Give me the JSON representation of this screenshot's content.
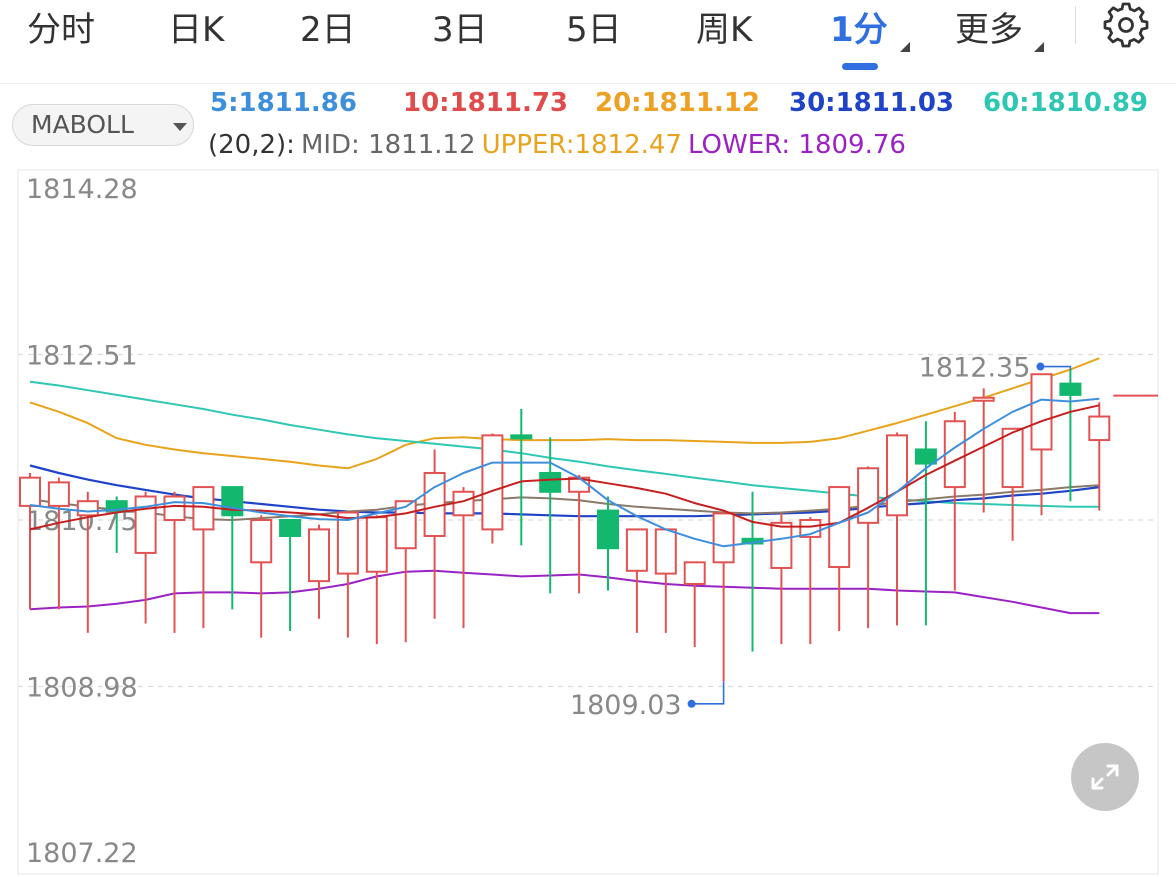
{
  "tabs": [
    {
      "label": "分时"
    },
    {
      "label": "日K"
    },
    {
      "label": "2日"
    },
    {
      "label": "3日"
    },
    {
      "label": "5日"
    },
    {
      "label": "周K"
    },
    {
      "label": "1分"
    },
    {
      "label": "更多"
    }
  ],
  "active_tab": "1分",
  "indicator_select": "MABOLL",
  "ma": {
    "ma5": "5:1811.86",
    "ma10": "10:1811.73",
    "ma20": "20:1811.12",
    "ma30": "30:1811.03",
    "ma60": "60:1810.89"
  },
  "boll": {
    "params": "(20,2):",
    "mid": "MID: 1811.12",
    "upper": "UPPER:1812.47",
    "lower": "LOWER: 1809.76"
  },
  "colors": {
    "accent": "#2f6fe0",
    "ma5": "#3d8fdc",
    "ma10": "#e04b4b",
    "ma20": "#eea022",
    "ma30": "#1f44c8",
    "ma60": "#2ec7b3",
    "boll_upper": "#e8a21c",
    "boll_mid": "#8a7a6a",
    "boll_lower": "#9a22c4",
    "up": "#e15252",
    "down": "#12b86d"
  },
  "chart_data": {
    "type": "candlestick",
    "y_ticks": [
      "1814.28",
      "1812.51",
      "1810.75",
      "1808.98",
      "1807.22"
    ],
    "ylim": [
      1807.22,
      1814.28
    ],
    "high_marker": "1812.35",
    "low_marker": "1809.03",
    "candles": [
      {
        "o": 1810.9,
        "c": 1811.2,
        "h": 1811.25,
        "l": 1809.8
      },
      {
        "o": 1810.9,
        "c": 1811.15,
        "h": 1811.2,
        "l": 1809.8
      },
      {
        "o": 1810.8,
        "c": 1810.95,
        "h": 1811.05,
        "l": 1809.55
      },
      {
        "o": 1810.95,
        "c": 1810.85,
        "h": 1811.0,
        "l": 1810.4
      },
      {
        "o": 1810.4,
        "c": 1811.0,
        "h": 1811.05,
        "l": 1809.65
      },
      {
        "o": 1810.75,
        "c": 1811.0,
        "h": 1811.05,
        "l": 1809.55
      },
      {
        "o": 1810.65,
        "c": 1811.1,
        "h": 1811.1,
        "l": 1809.6
      },
      {
        "o": 1811.1,
        "c": 1810.8,
        "h": 1811.1,
        "l": 1809.8
      },
      {
        "o": 1810.3,
        "c": 1810.75,
        "h": 1810.8,
        "l": 1809.5
      },
      {
        "o": 1810.75,
        "c": 1810.58,
        "h": 1810.75,
        "l": 1809.57
      },
      {
        "o": 1810.1,
        "c": 1810.65,
        "h": 1810.7,
        "l": 1809.7
      },
      {
        "o": 1810.18,
        "c": 1810.83,
        "h": 1810.84,
        "l": 1809.5
      },
      {
        "o": 1810.2,
        "c": 1810.78,
        "h": 1810.8,
        "l": 1809.43
      },
      {
        "o": 1810.45,
        "c": 1810.95,
        "h": 1810.95,
        "l": 1809.45
      },
      {
        "o": 1810.58,
        "c": 1811.25,
        "h": 1811.5,
        "l": 1809.7
      },
      {
        "o": 1810.8,
        "c": 1811.05,
        "h": 1811.1,
        "l": 1809.6
      },
      {
        "o": 1810.65,
        "c": 1811.65,
        "h": 1811.67,
        "l": 1810.5
      },
      {
        "o": 1811.65,
        "c": 1811.64,
        "h": 1811.93,
        "l": 1810.48
      },
      {
        "o": 1811.25,
        "c": 1811.05,
        "h": 1811.63,
        "l": 1809.97
      },
      {
        "o": 1811.05,
        "c": 1811.2,
        "h": 1811.23,
        "l": 1809.97
      },
      {
        "o": 1810.85,
        "c": 1810.45,
        "h": 1811.0,
        "l": 1810.0
      },
      {
        "o": 1810.21,
        "c": 1810.65,
        "h": 1810.65,
        "l": 1809.55
      },
      {
        "o": 1810.18,
        "c": 1810.65,
        "h": 1810.65,
        "l": 1809.55
      },
      {
        "o": 1810.07,
        "c": 1810.3,
        "h": 1810.3,
        "l": 1809.4
      },
      {
        "o": 1810.3,
        "c": 1810.82,
        "h": 1810.82,
        "l": 1809.03
      },
      {
        "o": 1810.55,
        "c": 1810.5,
        "h": 1811.05,
        "l": 1809.35
      },
      {
        "o": 1810.24,
        "c": 1810.72,
        "h": 1810.82,
        "l": 1809.43
      },
      {
        "o": 1810.57,
        "c": 1810.75,
        "h": 1810.78,
        "l": 1809.43
      },
      {
        "o": 1810.25,
        "c": 1811.1,
        "h": 1811.11,
        "l": 1809.57
      },
      {
        "o": 1810.72,
        "c": 1811.3,
        "h": 1811.32,
        "l": 1809.6
      },
      {
        "o": 1810.8,
        "c": 1811.65,
        "h": 1811.68,
        "l": 1809.63
      },
      {
        "o": 1811.5,
        "c": 1811.35,
        "h": 1811.8,
        "l": 1809.63
      },
      {
        "o": 1811.1,
        "c": 1811.8,
        "h": 1811.9,
        "l": 1810.0
      },
      {
        "o": 1812.05,
        "c": 1812.05,
        "h": 1812.15,
        "l": 1810.83
      },
      {
        "o": 1811.1,
        "c": 1811.72,
        "h": 1811.72,
        "l": 1810.53
      },
      {
        "o": 1811.5,
        "c": 1812.3,
        "h": 1812.3,
        "l": 1810.8
      },
      {
        "o": 1812.2,
        "c": 1812.08,
        "h": 1812.35,
        "l": 1810.95
      },
      {
        "o": 1811.6,
        "c": 1811.85,
        "h": 1812.0,
        "l": 1810.85
      }
    ],
    "series": [
      {
        "name": "5",
        "values": [
          1810.91,
          1810.87,
          1810.84,
          1810.86,
          1810.89,
          1810.94,
          1810.93,
          1810.88,
          1810.83,
          1810.79,
          1810.76,
          1810.75,
          1810.82,
          1810.89,
          1811.1,
          1811.25,
          1811.36,
          1811.36,
          1811.36,
          1811.2,
          1810.96,
          1810.79,
          1810.65,
          1810.55,
          1810.47,
          1810.51,
          1810.55,
          1810.6,
          1810.72,
          1810.83,
          1811.05,
          1811.3,
          1811.52,
          1811.72,
          1811.9,
          1812.03,
          1812.01,
          1812.04
        ]
      },
      {
        "name": "10",
        "values": [
          1810.65,
          1810.72,
          1810.78,
          1810.83,
          1810.87,
          1810.9,
          1810.89,
          1810.86,
          1810.85,
          1810.83,
          1810.81,
          1810.77,
          1810.78,
          1810.82,
          1810.89,
          1810.95,
          1811.06,
          1811.16,
          1811.18,
          1811.19,
          1811.14,
          1811.09,
          1811.03,
          1810.93,
          1810.85,
          1810.73,
          1810.68,
          1810.68,
          1810.72,
          1810.88,
          1811.05,
          1811.23,
          1811.38,
          1811.53,
          1811.68,
          1811.8,
          1811.9,
          1811.97
        ]
      },
      {
        "name": "20",
        "values": [
          1812.0,
          1811.92,
          1811.83,
          1811.7,
          1811.62,
          1811.53,
          1811.5,
          1811.46,
          1811.42,
          1811.39,
          1811.34,
          1811.3,
          1811.31,
          1811.5,
          1811.58,
          1811.6,
          1811.6,
          1811.61,
          1811.6,
          1811.6,
          1811.61,
          1811.6,
          1811.59,
          1811.58,
          1811.57,
          1811.56,
          1811.56,
          1811.57,
          1811.6,
          1811.67,
          1811.74,
          1811.82,
          1811.9,
          1811.99,
          1812.07,
          1812.15,
          1812.25,
          1812.35
        ]
      },
      {
        "name": "30",
        "values": [
          1811.33,
          1811.25,
          1811.18,
          1811.12,
          1811.07,
          1811.02,
          1810.98,
          1810.95,
          1810.92,
          1810.89,
          1810.86,
          1810.84,
          1810.83,
          1810.83,
          1810.82,
          1810.82,
          1810.82,
          1810.81,
          1810.8,
          1810.79,
          1810.79,
          1810.79,
          1810.79,
          1810.79,
          1810.8,
          1810.81,
          1810.82,
          1810.83,
          1810.85,
          1810.88,
          1810.91,
          1810.93,
          1810.96,
          1810.98,
          1811.01,
          1811.03,
          1811.06,
          1811.1
        ]
      },
      {
        "name": "60",
        "values": [
          1812.22,
          1812.18,
          1812.13,
          1812.08,
          1812.03,
          1811.98,
          1811.93,
          1811.87,
          1811.82,
          1811.76,
          1811.71,
          1811.66,
          1811.62,
          1811.59,
          1811.56,
          1811.53,
          1811.5,
          1811.46,
          1811.41,
          1811.37,
          1811.32,
          1811.28,
          1811.24,
          1811.2,
          1811.16,
          1811.12,
          1811.09,
          1811.06,
          1811.03,
          1811.0,
          1810.97,
          1810.95,
          1810.93,
          1810.92,
          1810.91,
          1810.9,
          1810.89,
          1810.89
        ]
      },
      {
        "name": "MID",
        "values": [
          1810.97,
          1810.93,
          1810.89,
          1810.86,
          1810.83,
          1810.79,
          1810.76,
          1810.75,
          1810.77,
          1810.79,
          1810.81,
          1810.84,
          1810.86,
          1810.9,
          1810.93,
          1810.95,
          1810.97,
          1810.99,
          1810.98,
          1810.96,
          1810.92,
          1810.89,
          1810.87,
          1810.85,
          1810.83,
          1810.82,
          1810.83,
          1810.85,
          1810.87,
          1810.9,
          1810.94,
          1810.97,
          1811.0,
          1811.02,
          1811.05,
          1811.07,
          1811.1,
          1811.12
        ]
      },
      {
        "name": "UPPER",
        "values": [
          1812.0,
          1811.9,
          1811.78,
          1811.62,
          1811.55,
          1811.5,
          1811.46,
          1811.43,
          1811.4,
          1811.37,
          1811.33,
          1811.3,
          1811.4,
          1811.55,
          1811.62,
          1811.63,
          1811.61,
          1811.6,
          1811.6,
          1811.6,
          1811.61,
          1811.6,
          1811.6,
          1811.59,
          1811.58,
          1811.57,
          1811.57,
          1811.58,
          1811.62,
          1811.7,
          1811.78,
          1811.87,
          1811.96,
          1812.05,
          1812.15,
          1812.25,
          1812.35,
          1812.47
        ]
      },
      {
        "name": "LOWER",
        "values": [
          1809.8,
          1809.82,
          1809.83,
          1809.86,
          1809.9,
          1809.97,
          1809.98,
          1809.98,
          1809.97,
          1809.98,
          1810.02,
          1810.07,
          1810.15,
          1810.2,
          1810.21,
          1810.19,
          1810.17,
          1810.15,
          1810.16,
          1810.17,
          1810.14,
          1810.1,
          1810.07,
          1810.05,
          1810.04,
          1810.03,
          1810.02,
          1810.02,
          1810.02,
          1810.02,
          1810.0,
          1809.99,
          1809.98,
          1809.93,
          1809.88,
          1809.82,
          1809.76,
          1809.76
        ]
      }
    ]
  }
}
